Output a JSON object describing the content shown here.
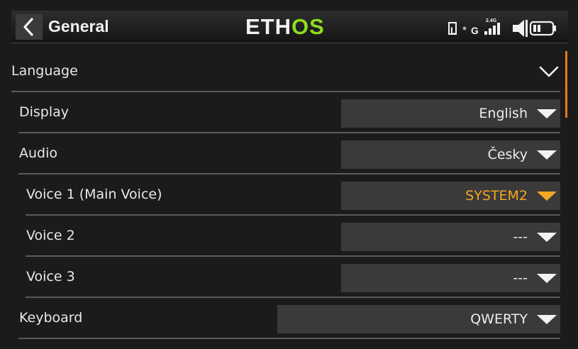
{
  "header": {
    "title": "General",
    "logo_eth": "ETH",
    "logo_os": "OS",
    "radio_band": "2.4G",
    "link_indicator_l": "L",
    "link_indicator_g": "G"
  },
  "section": {
    "label": "Language"
  },
  "rows": [
    {
      "label": "Display",
      "value": "English"
    },
    {
      "label": "Audio",
      "value": "Česky"
    },
    {
      "label": "Voice 1 (Main Voice)",
      "value": "SYSTEM2"
    },
    {
      "label": "Voice 2",
      "value": "---"
    },
    {
      "label": "Voice 3",
      "value": "---"
    },
    {
      "label": "Keyboard",
      "value": "QWERTY"
    }
  ],
  "colors": {
    "accent": "#f5a623",
    "logo_green": "#8edc1e",
    "scrollbar": "#e87b16"
  }
}
